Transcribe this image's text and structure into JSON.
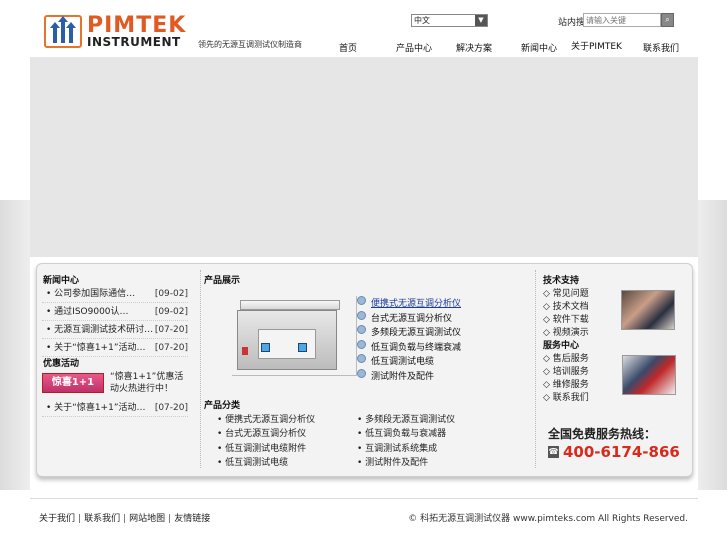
{
  "brand": {
    "logo_text_main": "PIMTEK",
    "logo_text_sub": "INSTRUMENT",
    "slogan": "领先的无源互调测试仪制造商"
  },
  "header": {
    "language_selected": "中文",
    "search_label": "站内搜索：",
    "search_placeholder": "请输入关键",
    "nav": [
      "首页",
      "产品中心",
      "解决方案",
      "新闻中心",
      "关于PIMTEK",
      "联系我们"
    ]
  },
  "news": {
    "title": "新闻中心",
    "items": [
      {
        "title": "公司参加国际通信…",
        "date": "[09-02]"
      },
      {
        "title": "通过ISO9000认…",
        "date": "[09-02]"
      },
      {
        "title": "无源互调测试技术研讨…",
        "date": "[07-20]"
      },
      {
        "title": "关于“惊喜1+1”活动…",
        "date": "[07-20]"
      }
    ]
  },
  "promo": {
    "title": "优惠活动",
    "badge": "惊喜1+1",
    "text": "“惊喜1+1”优惠活动火热进行中！",
    "item": {
      "title": "关于“惊喜1+1”活动…",
      "date": "[07-20]"
    }
  },
  "products": {
    "title": "产品展示",
    "links": [
      "便携式无源互调分析仪",
      "台式无源互调分析仪",
      "多频段无源互调测试仪",
      "低互调负载与终端衰减",
      "低互调测试电缆",
      "测试附件及配件"
    ],
    "categories_title": "产品分类",
    "categories": [
      "便携式无源互调分析仪",
      "多频段无源互调测试仪",
      "台式无源互调分析仪",
      "低互调负载与衰减器",
      "低互调测试电缆附件",
      "互调测试系统集成",
      "低互调测试电缆",
      "测试附件及配件"
    ]
  },
  "service": {
    "title1": "技术支持",
    "items1": [
      "常见问题",
      "技术文档",
      "软件下载",
      "视频演示"
    ],
    "title2": "服务中心",
    "items2": [
      "售后服务",
      "培训服务",
      "维修服务",
      "联系我们"
    ],
    "bullet": "◇",
    "hotline_label": "全国免费服务热线：",
    "hotline_number": "400-6174-866"
  },
  "footer": {
    "links": [
      "关于我们",
      "联系我们",
      "网站地图",
      "友情链接"
    ],
    "copyright_symbol": "©",
    "copyright_text": "科拓无源互调测试仪器 www.pimteks.com All Rights Reserved."
  }
}
